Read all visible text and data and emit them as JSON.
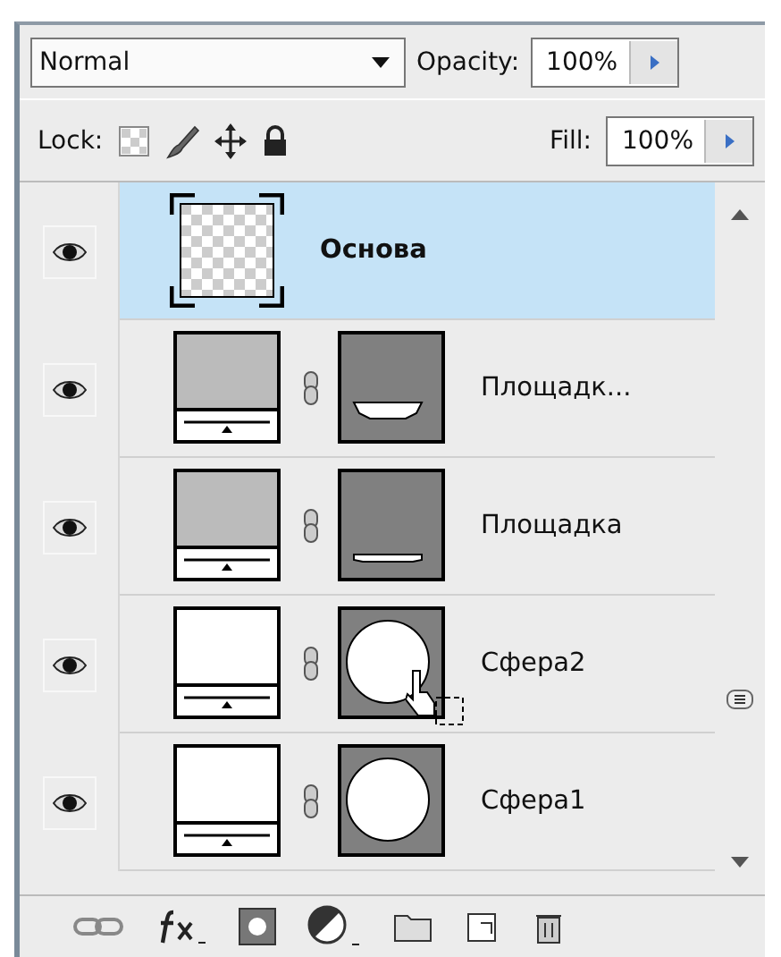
{
  "blend_mode": {
    "value": "Normal"
  },
  "opacity": {
    "label": "Opacity:",
    "value": "100%"
  },
  "lock": {
    "label": "Lock:"
  },
  "fill": {
    "label": "Fill:",
    "value": "100%"
  },
  "layers": [
    {
      "kind": "pixel",
      "name": "Основа",
      "visible": true,
      "selected": true
    },
    {
      "kind": "adjustment",
      "name": "Площадк...",
      "visible": true,
      "selected": false,
      "color": "#bbbbbb",
      "mask": {
        "kind": "bowl"
      },
      "cursor": false
    },
    {
      "kind": "adjustment",
      "name": "Площадка",
      "visible": true,
      "selected": false,
      "color": "#bbbbbb",
      "mask": {
        "kind": "dish"
      },
      "cursor": false
    },
    {
      "kind": "adjustment",
      "name": "Сфера2",
      "visible": true,
      "selected": false,
      "color": "#ffffff",
      "mask": {
        "kind": "circle"
      },
      "cursor": true
    },
    {
      "kind": "adjustment",
      "name": "Сфера1",
      "visible": true,
      "selected": false,
      "color": "#ffffff",
      "mask": {
        "kind": "circle"
      },
      "cursor": false
    }
  ]
}
